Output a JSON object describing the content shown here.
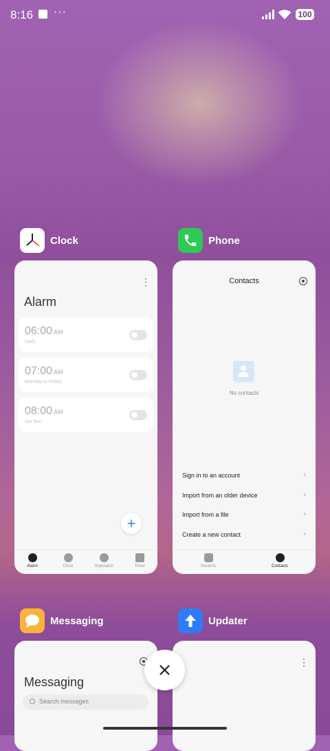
{
  "status_bar": {
    "time": "8:16",
    "dots": "···",
    "battery": "100"
  },
  "clock": {
    "app_name": "Clock",
    "title": "Alarm",
    "alarms": [
      {
        "time": "06:00",
        "ampm": "AM",
        "repeat": "Daily"
      },
      {
        "time": "07:00",
        "ampm": "AM",
        "repeat": "Monday to Friday"
      },
      {
        "time": "08:00",
        "ampm": "AM",
        "repeat": "Sat Sun"
      }
    ],
    "nav": [
      "Alarm",
      "Clock",
      "Stopwatch",
      "Timer"
    ],
    "fab": "+"
  },
  "phone": {
    "app_name": "Phone",
    "title": "Contacts",
    "empty": "No contacts",
    "options": [
      "Sign in to an account",
      "Import from an older device",
      "Import from a file",
      "Create a new contact"
    ],
    "nav": [
      "Recents",
      "Contacts"
    ]
  },
  "messaging": {
    "app_name": "Messaging",
    "title": "Messaging",
    "search_placeholder": "Search messages"
  },
  "updater": {
    "app_name": "Updater"
  },
  "colors": {
    "phone_green": "#2fc955",
    "messaging_orange": "#f9b23b",
    "updater_blue": "#2f7cf6",
    "fab_blue": "#2f88df"
  }
}
